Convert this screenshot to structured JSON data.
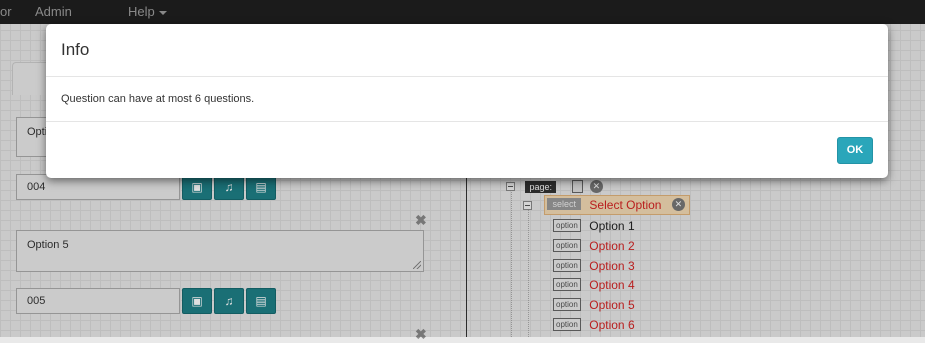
{
  "navbar": {
    "items": [
      {
        "label": "or"
      },
      {
        "label": "Admin"
      },
      {
        "label": "Help"
      }
    ]
  },
  "left_panel": {
    "textareas": [
      {
        "value": "Opti"
      },
      {
        "value": "Option 5"
      }
    ],
    "inputs": [
      {
        "value": "004"
      },
      {
        "value": "005"
      }
    ],
    "media_icons": [
      "image-icon",
      "music-icon",
      "film-icon"
    ],
    "remove_glyph": "✖"
  },
  "tree": {
    "page_tag": "page:",
    "select_tag": "select",
    "select_label": "Select Option",
    "option_tag": "option",
    "options": [
      {
        "label": "Option 1",
        "color": "#222222"
      },
      {
        "label": "Option 2",
        "color": "#d32323"
      },
      {
        "label": "Option 3",
        "color": "#d32323"
      },
      {
        "label": "Option 4",
        "color": "#d32323"
      },
      {
        "label": "Option 5",
        "color": "#d32323"
      },
      {
        "label": "Option 6",
        "color": "#d32323"
      }
    ]
  },
  "modal": {
    "title": "Info",
    "message": "Question can have at most 6 questions.",
    "ok_label": "OK"
  },
  "colors": {
    "accent": "#2aa6ba",
    "media_button": "#1e7f86",
    "error_text": "#d32323"
  }
}
